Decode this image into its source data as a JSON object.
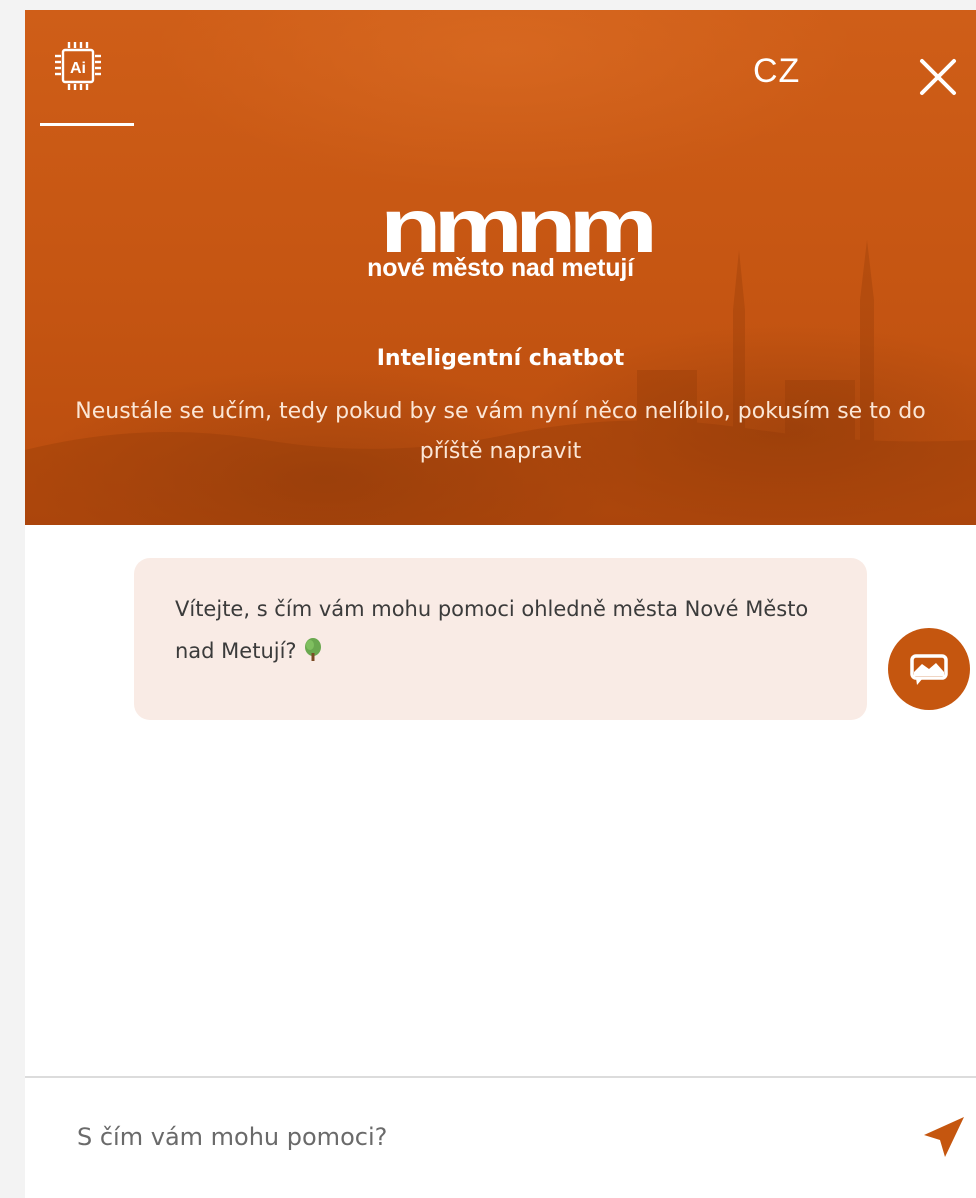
{
  "header": {
    "ai_badge": "Ai",
    "language": "CZ",
    "logo_mark": "nmnm",
    "logo_text": "nové město nad metují",
    "title": "Inteligentní chatbot",
    "subtitle": "Neustále se učím, tedy pokud by se vám nyní něco nelíbilo, pokusím se to do příště napravit"
  },
  "messages": [
    {
      "text": "Vítejte, s čím vám mohu pomoci ohledně města Nové Město nad Metují?",
      "emoji_icon": "tree-icon"
    }
  ],
  "input": {
    "placeholder": "S čím vám mohu pomoci?",
    "value": ""
  },
  "colors": {
    "brand": "#c5560f",
    "bubble": "#f9ebe5",
    "send": "#c5560f"
  }
}
